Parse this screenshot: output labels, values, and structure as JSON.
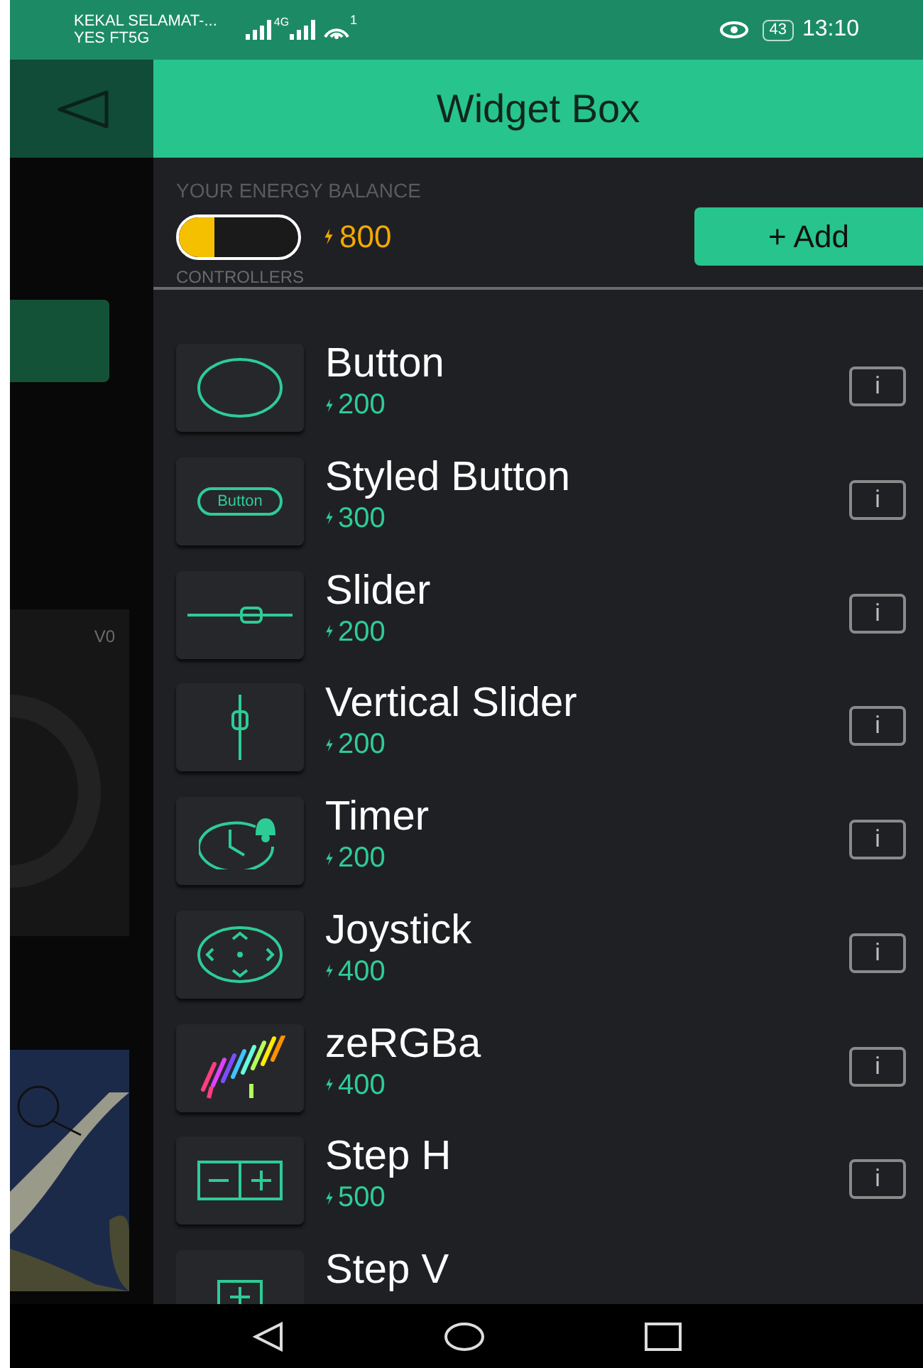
{
  "status_bar": {
    "carrier_1": "KEKAL SELAMAT-...",
    "carrier_2": "YES FT5G",
    "network": "4G",
    "wifi_badge": "1",
    "battery": "43",
    "time": "13:10"
  },
  "background_app": {
    "pin_label": "V0"
  },
  "header": {
    "title": "Widget Box"
  },
  "energy": {
    "label": "YOUR ENERGY BALANCE",
    "level": 0.3,
    "amount": "800",
    "add_button": "+ Add"
  },
  "section": {
    "title": "CONTROLLERS"
  },
  "widgets": [
    {
      "kind": "button",
      "name": "Button",
      "price": "200",
      "info": "i"
    },
    {
      "kind": "styled_button",
      "name": "Styled Button",
      "price": "300",
      "icon_label": "Button",
      "info": "i"
    },
    {
      "kind": "slider",
      "name": "Slider",
      "price": "200",
      "info": "i"
    },
    {
      "kind": "vertical_slider",
      "name": "Vertical Slider",
      "price": "200",
      "info": "i"
    },
    {
      "kind": "timer",
      "name": "Timer",
      "price": "200",
      "info": "i"
    },
    {
      "kind": "joystick",
      "name": "Joystick",
      "price": "400",
      "info": "i"
    },
    {
      "kind": "zergba",
      "name": "zeRGBa",
      "price": "400",
      "info": "i"
    },
    {
      "kind": "step_h",
      "name": "Step H",
      "price": "500",
      "info": "i"
    },
    {
      "kind": "step_v",
      "name": "Step V"
    }
  ]
}
